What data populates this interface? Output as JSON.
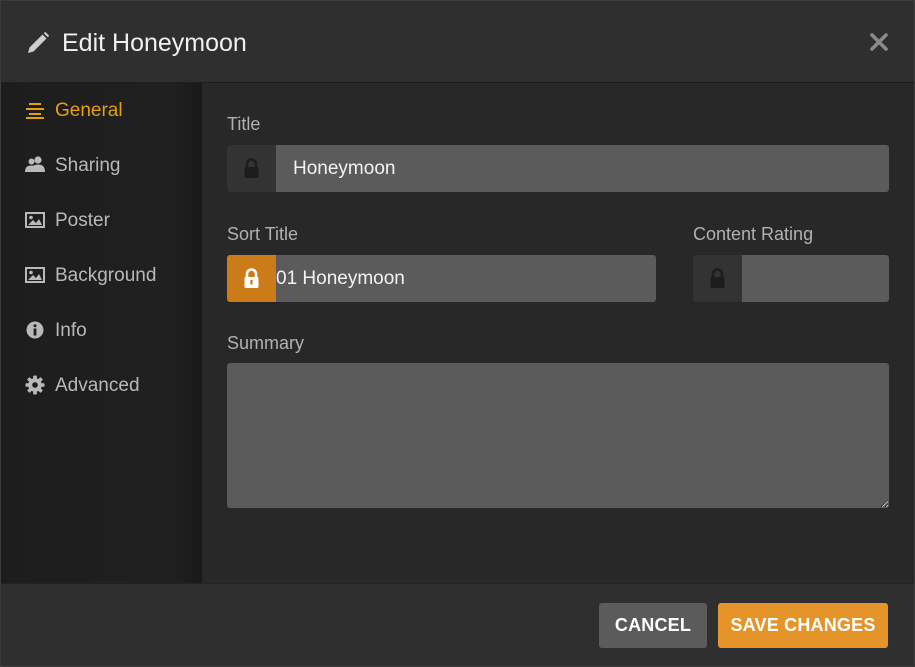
{
  "dialog": {
    "title": "Edit Honeymoon"
  },
  "sidebar": {
    "items": [
      {
        "label": "General",
        "icon": "list-lines-icon",
        "active": true
      },
      {
        "label": "Sharing",
        "icon": "users-icon",
        "active": false
      },
      {
        "label": "Poster",
        "icon": "image-icon",
        "active": false
      },
      {
        "label": "Background",
        "icon": "image-icon",
        "active": false
      },
      {
        "label": "Info",
        "icon": "info-circle-icon",
        "active": false
      },
      {
        "label": "Advanced",
        "icon": "gear-icon",
        "active": false
      }
    ]
  },
  "form": {
    "title": {
      "label": "Title",
      "value": "Honeymoon",
      "locked": false
    },
    "sort_title": {
      "label": "Sort Title",
      "value": "01 Honeymoon",
      "locked": true
    },
    "content_rating": {
      "label": "Content Rating",
      "value": "",
      "locked": false
    },
    "summary": {
      "label": "Summary",
      "value": ""
    }
  },
  "footer": {
    "cancel_label": "CANCEL",
    "save_label": "SAVE CHANGES"
  },
  "colors": {
    "accent": "#e5a00d",
    "save_button": "#e5942a",
    "lock_active": "#cc7b19"
  }
}
